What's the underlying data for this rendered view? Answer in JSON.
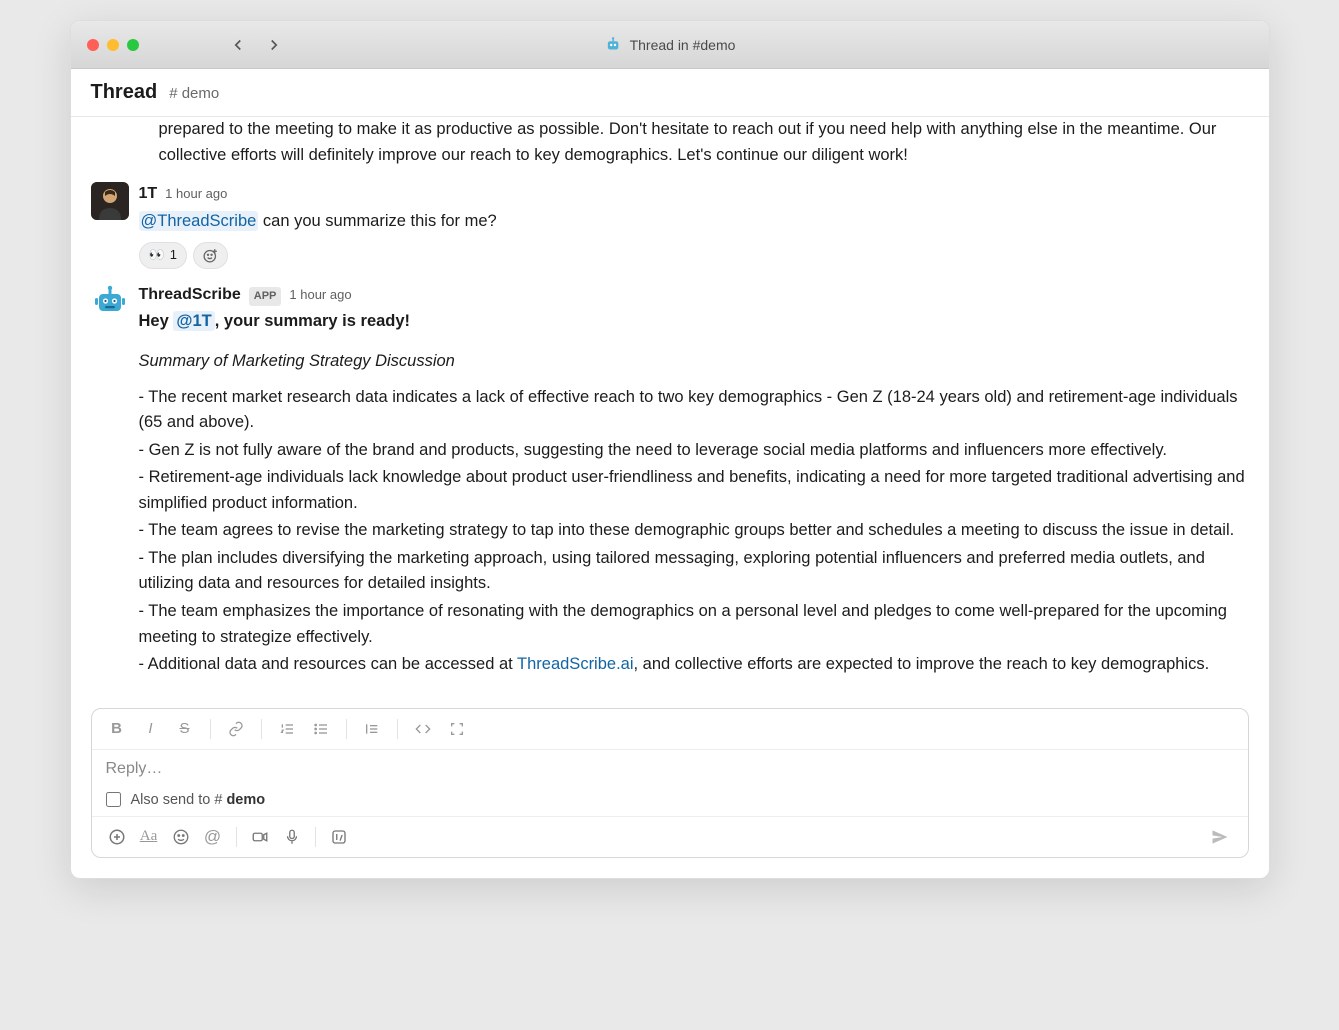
{
  "window": {
    "title": "Thread in #demo"
  },
  "header": {
    "title": "Thread",
    "channel": "demo"
  },
  "partial_message": {
    "text": "prepared to the meeting to make it as productive as possible. Don't hesitate to reach out if you need help with anything else in the meantime. Our collective efforts will definitely improve our reach to key demographics. Let's continue our diligent work!"
  },
  "user_message": {
    "author": "1T",
    "timestamp": "1 hour ago",
    "mention": "@ThreadScribe",
    "text_after": " can you summarize this for me?",
    "reactions": {
      "eyes": {
        "emoji": "👀",
        "count": "1"
      }
    }
  },
  "bot_message": {
    "author": "ThreadScribe",
    "badge": "APP",
    "timestamp": "1 hour ago",
    "greeting_prefix": "Hey ",
    "greeting_mention": "@1T",
    "greeting_suffix": ", your summary is ready!",
    "summary_title": "Summary of Marketing Strategy Discussion",
    "bullets": [
      "- The recent market research data indicates a lack of effective reach to two key demographics - Gen Z (18-24 years old) and retirement-age individuals (65 and above).",
      "- Gen Z is not fully aware of the brand and products, suggesting the need to leverage social media platforms and influencers more effectively.",
      "- Retirement-age individuals lack knowledge about product user-friendliness and benefits, indicating a need for more targeted traditional advertising and simplified product information.",
      "- The team agrees to revise the marketing strategy to tap into these demographic groups better and schedules a meeting to discuss the issue in detail.",
      "- The plan includes diversifying the marketing approach, using tailored messaging, exploring potential influencers and preferred media outlets, and utilizing data and resources for detailed insights.",
      "- The team emphasizes the importance of resonating with the demographics on a personal level and pledges to come well-prepared for the upcoming meeting to strategize effectively."
    ],
    "last_bullet_prefix": "- Additional data and resources can be accessed at ",
    "last_bullet_link": "ThreadScribe.ai",
    "last_bullet_suffix": ", and collective efforts are expected to improve the reach to key demographics."
  },
  "composer": {
    "placeholder": "Reply…",
    "also_send_prefix": "Also send to ",
    "also_send_channel": "demo"
  }
}
